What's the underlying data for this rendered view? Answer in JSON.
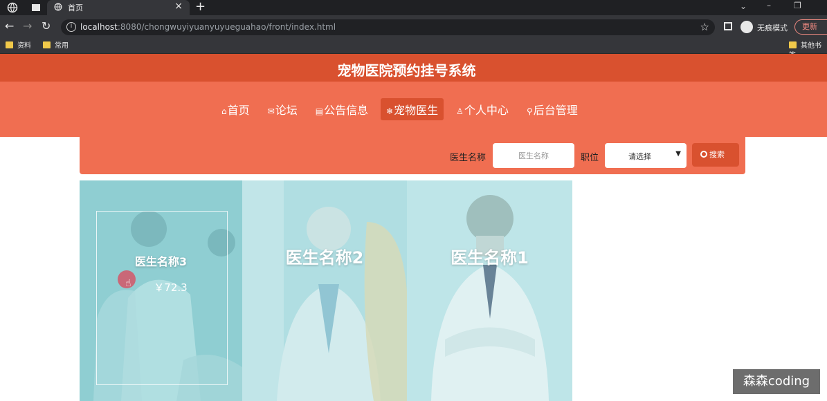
{
  "browser": {
    "tab_title": "首页",
    "url_host": "localhost",
    "url_rest": ":8080/chongwuyiyuanyuyueguahao/front/index.html",
    "incognito_label": "无痕模式",
    "update_label": "更新",
    "bookmarks": [
      "资料",
      "常用"
    ],
    "other_bookmarks": "其他书签"
  },
  "site": {
    "title": "宠物医院预约挂号系统"
  },
  "nav": {
    "items": [
      {
        "icon": "⌂",
        "label": "首页"
      },
      {
        "icon": "✉",
        "label": "论坛"
      },
      {
        "icon": "▤",
        "label": "公告信息"
      },
      {
        "icon": "❄",
        "label": "宠物医生"
      },
      {
        "icon": "♙",
        "label": "个人中心"
      },
      {
        "icon": "⚲",
        "label": "后台管理"
      }
    ],
    "active_index": 3
  },
  "search": {
    "name_label": "医生名称",
    "name_placeholder": "医生名称",
    "position_label": "职位",
    "position_value": "请选择",
    "button_label": "搜索"
  },
  "doctors": [
    {
      "name": "医生名称3",
      "price": "￥72.3",
      "hovered": true
    },
    {
      "name": "医生名称2"
    },
    {
      "name": "医生名称1"
    }
  ],
  "colors": {
    "header_dark": "#d9512f",
    "header_light": "#f06e51",
    "card_overlay": "#9fd8dc"
  },
  "watermark": "森森coding"
}
